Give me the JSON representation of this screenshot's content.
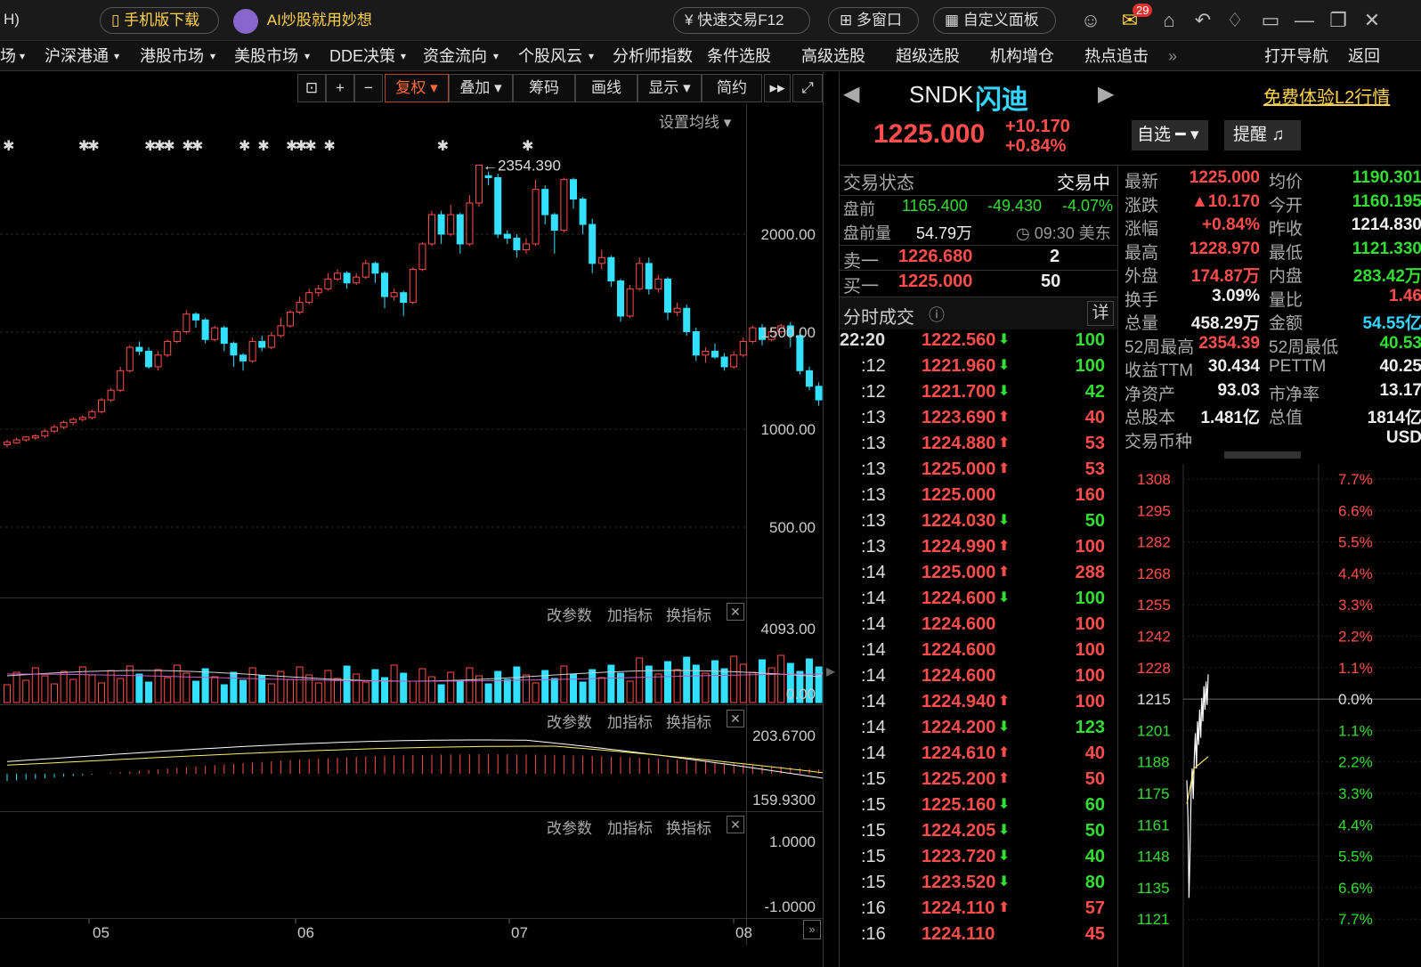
{
  "topbar": {
    "left_text": "H)",
    "mobile_download": "手机版下载",
    "ai_text": "AI炒股就用妙想",
    "quick_trade": "快速交易F12",
    "multi_window": "多窗口",
    "custom_panel": "自定义面板",
    "mail_badge": "29"
  },
  "menu": {
    "items": [
      "场",
      "沪深港通",
      "港股市场",
      "美股市场",
      "DDE决策",
      "资金流向",
      "个股风云",
      "分析师指数",
      "条件选股",
      "高级选股",
      "超级选股",
      "机构增仓",
      "热点追击",
      "»",
      "打开导航",
      "返回"
    ]
  },
  "toolbar": {
    "fuquan": "复权",
    "diejia": "叠加",
    "chouma": "筹码",
    "huaxian": "画线",
    "xianshi": "显示",
    "jianyue": "简约",
    "ma_setting": "设置均线"
  },
  "kline": {
    "max_label": "2354.390",
    "y_labels": [
      "2000.00",
      "1500.00",
      "1000.00",
      "500.00"
    ],
    "x_labels": [
      "05",
      "06",
      "07",
      "08"
    ],
    "candles": [
      [
        920,
        935,
        905,
        945
      ],
      [
        930,
        945,
        925,
        955
      ],
      [
        945,
        960,
        935,
        965
      ],
      [
        955,
        965,
        945,
        975
      ],
      [
        965,
        990,
        955,
        1000
      ],
      [
        990,
        1010,
        980,
        1025
      ],
      [
        1010,
        1035,
        1000,
        1045
      ],
      [
        1035,
        1050,
        1020,
        1060
      ],
      [
        1050,
        1060,
        1040,
        1070
      ],
      [
        1060,
        1090,
        1050,
        1100
      ],
      [
        1090,
        1150,
        1080,
        1160
      ],
      [
        1150,
        1200,
        1140,
        1210
      ],
      [
        1200,
        1300,
        1190,
        1320
      ],
      [
        1300,
        1420,
        1290,
        1430
      ],
      [
        1420,
        1400,
        1380,
        1450
      ],
      [
        1400,
        1320,
        1310,
        1420
      ],
      [
        1320,
        1380,
        1300,
        1400
      ],
      [
        1380,
        1450,
        1370,
        1460
      ],
      [
        1450,
        1500,
        1440,
        1510
      ],
      [
        1500,
        1590,
        1490,
        1610
      ],
      [
        1590,
        1560,
        1520,
        1600
      ],
      [
        1560,
        1460,
        1440,
        1570
      ],
      [
        1460,
        1520,
        1450,
        1530
      ],
      [
        1520,
        1440,
        1400,
        1530
      ],
      [
        1440,
        1380,
        1320,
        1450
      ],
      [
        1380,
        1350,
        1300,
        1390
      ],
      [
        1350,
        1450,
        1340,
        1470
      ],
      [
        1450,
        1420,
        1400,
        1480
      ],
      [
        1420,
        1480,
        1410,
        1500
      ],
      [
        1480,
        1530,
        1470,
        1570
      ],
      [
        1530,
        1600,
        1520,
        1610
      ],
      [
        1600,
        1650,
        1590,
        1680
      ],
      [
        1650,
        1700,
        1640,
        1720
      ],
      [
        1700,
        1720,
        1680,
        1740
      ],
      [
        1720,
        1770,
        1710,
        1800
      ],
      [
        1770,
        1800,
        1760,
        1820
      ],
      [
        1800,
        1750,
        1720,
        1810
      ],
      [
        1750,
        1780,
        1740,
        1800
      ],
      [
        1780,
        1850,
        1770,
        1870
      ],
      [
        1850,
        1800,
        1750,
        1860
      ],
      [
        1800,
        1680,
        1620,
        1810
      ],
      [
        1680,
        1700,
        1660,
        1720
      ],
      [
        1700,
        1650,
        1580,
        1710
      ],
      [
        1650,
        1820,
        1640,
        1830
      ],
      [
        1820,
        1950,
        1810,
        1960
      ],
      [
        1950,
        2100,
        1940,
        2120
      ],
      [
        2100,
        2000,
        1950,
        2120
      ],
      [
        2000,
        2100,
        1990,
        2150
      ],
      [
        2100,
        1950,
        1900,
        2110
      ],
      [
        1950,
        2160,
        1940,
        2200
      ],
      [
        2160,
        2354,
        2140,
        2354
      ],
      [
        2300,
        2290,
        2250,
        2320
      ],
      [
        2290,
        2000,
        1980,
        2310
      ],
      [
        2000,
        1980,
        1950,
        2020
      ],
      [
        1980,
        1920,
        1880,
        2000
      ],
      [
        1920,
        1950,
        1900,
        1980
      ],
      [
        1950,
        2230,
        1940,
        2280
      ],
      [
        2230,
        2100,
        2050,
        2250
      ],
      [
        2100,
        2020,
        1900,
        2110
      ],
      [
        2020,
        2280,
        2010,
        2290
      ],
      [
        2280,
        2180,
        2130,
        2290
      ],
      [
        2180,
        2050,
        2000,
        2190
      ],
      [
        2050,
        1850,
        1800,
        2080
      ],
      [
        1850,
        1880,
        1820,
        1920
      ],
      [
        1880,
        1760,
        1730,
        1890
      ],
      [
        1760,
        1580,
        1550,
        1770
      ],
      [
        1580,
        1720,
        1570,
        1740
      ],
      [
        1720,
        1850,
        1710,
        1880
      ],
      [
        1850,
        1720,
        1690,
        1880
      ],
      [
        1720,
        1770,
        1700,
        1790
      ],
      [
        1770,
        1600,
        1560,
        1780
      ],
      [
        1600,
        1620,
        1580,
        1650
      ],
      [
        1620,
        1500,
        1480,
        1640
      ],
      [
        1500,
        1380,
        1350,
        1520
      ],
      [
        1380,
        1400,
        1340,
        1420
      ],
      [
        1400,
        1370,
        1360,
        1440
      ],
      [
        1370,
        1320,
        1300,
        1390
      ],
      [
        1320,
        1380,
        1310,
        1400
      ],
      [
        1380,
        1450,
        1370,
        1470
      ],
      [
        1450,
        1520,
        1440,
        1530
      ],
      [
        1520,
        1460,
        1430,
        1540
      ],
      [
        1460,
        1500,
        1450,
        1520
      ],
      [
        1500,
        1530,
        1490,
        1540
      ],
      [
        1530,
        1480,
        1420,
        1550
      ],
      [
        1480,
        1300,
        1280,
        1500
      ],
      [
        1300,
        1220,
        1200,
        1320
      ],
      [
        1220,
        1150,
        1120,
        1240
      ],
      [
        1150,
        1050,
        1040,
        1180
      ],
      [
        1050,
        1100,
        1030,
        1110
      ],
      [
        1100,
        1240,
        1080,
        1250
      ],
      [
        1240,
        1280,
        1220,
        1290
      ],
      [
        1280,
        1380,
        1270,
        1400
      ],
      [
        1380,
        1220,
        1200,
        1400
      ],
      [
        1214.83,
        1225,
        1150,
        1230
      ]
    ]
  },
  "volume": {
    "max_label": "4093.00",
    "zero_label": "0.00",
    "params": "改参数",
    "add": "加指标",
    "swap": "换指标"
  },
  "macd": {
    "top_label": "203.6700",
    "bottom_label": "159.9300",
    "params": "改参数",
    "add": "加指标",
    "swap": "换指标"
  },
  "third": {
    "top_label": "1.0000",
    "bottom_label": "-1.0000",
    "params": "改参数",
    "add": "加指标",
    "swap": "换指标"
  },
  "quote": {
    "code": "SNDK",
    "name": "闪迪",
    "price": "1225.000",
    "change": "+10.170",
    "change_pct": "+0.84%",
    "l2_link": "免费体验L2行情",
    "zixuan": "自选",
    "tixing": "提醒",
    "trade_status_label": "交易状态",
    "trade_status": "交易中",
    "premarket_label": "盘前",
    "premarket_price": "1165.400",
    "premarket_change": "-49.430",
    "premarket_pct": "-4.07%",
    "premarket_vol_label": "盘前量",
    "premarket_vol": "54.79万",
    "premarket_time": "09:30 美东",
    "sell1_label": "卖一",
    "sell1_price": "1226.680",
    "sell1_vol": "2",
    "buy1_label": "买一",
    "buy1_price": "1225.000",
    "buy1_vol": "50",
    "ticks_title": "分时成交",
    "detail": "详"
  },
  "stats": [
    {
      "l1": "最新",
      "v1": "1225.000",
      "c1": "red",
      "l2": "均价",
      "v2": "1190.301",
      "c2": "green"
    },
    {
      "l1": "涨跌",
      "v1": "▲10.170",
      "c1": "red",
      "l2": "今开",
      "v2": "1160.195",
      "c2": "green"
    },
    {
      "l1": "涨幅",
      "v1": "+0.84%",
      "c1": "red",
      "l2": "昨收",
      "v2": "1214.830",
      "c2": "white"
    },
    {
      "l1": "最高",
      "v1": "1228.970",
      "c1": "red",
      "l2": "最低",
      "v2": "1121.330",
      "c2": "green"
    },
    {
      "l1": "外盘",
      "v1": "174.87万",
      "c1": "red",
      "l2": "内盘",
      "v2": "283.42万",
      "c2": "green"
    },
    {
      "l1": "换手",
      "v1": "3.09%",
      "c1": "white",
      "l2": "量比",
      "v2": "1.46",
      "c2": "red"
    },
    {
      "l1": "总量",
      "v1": "458.29万",
      "c1": "white",
      "l2": "金额",
      "v2": "54.55亿",
      "c2": "cyan"
    },
    {
      "l1": "52周最高",
      "v1": "2354.39",
      "c1": "red",
      "l2": "52周最低",
      "v2": "40.53",
      "c2": "green"
    },
    {
      "l1": "收益TTM",
      "v1": "30.434",
      "c1": "white",
      "l2": "PETTM",
      "v2": "40.25",
      "c2": "white"
    },
    {
      "l1": "净资产",
      "v1": "93.03",
      "c1": "white",
      "l2": "市净率",
      "v2": "13.17",
      "c2": "white"
    },
    {
      "l1": "总股本",
      "v1": "1.481亿",
      "c1": "white",
      "l2": "总值",
      "v2": "1814亿",
      "c2": "white"
    },
    {
      "l1": "交易币种",
      "v1": "",
      "c1": "white",
      "l2": "",
      "v2": "USD",
      "c2": "white"
    }
  ],
  "ticks": [
    {
      "t": "22:20",
      "p": "1222.560",
      "d": "down",
      "v": "100"
    },
    {
      "t": ":12",
      "p": "1221.960",
      "d": "down",
      "v": "100"
    },
    {
      "t": ":12",
      "p": "1221.700",
      "d": "down",
      "v": "42"
    },
    {
      "t": ":13",
      "p": "1223.690",
      "d": "up",
      "v": "40"
    },
    {
      "t": ":13",
      "p": "1224.880",
      "d": "up",
      "v": "53"
    },
    {
      "t": ":13",
      "p": "1225.000",
      "d": "up",
      "v": "53"
    },
    {
      "t": ":13",
      "p": "1225.000",
      "d": "",
      "v": "160"
    },
    {
      "t": ":13",
      "p": "1224.030",
      "d": "down",
      "v": "50"
    },
    {
      "t": ":13",
      "p": "1224.990",
      "d": "up",
      "v": "100"
    },
    {
      "t": ":14",
      "p": "1225.000",
      "d": "up",
      "v": "288"
    },
    {
      "t": ":14",
      "p": "1224.600",
      "d": "down",
      "v": "100"
    },
    {
      "t": ":14",
      "p": "1224.600",
      "d": "",
      "v": "100"
    },
    {
      "t": ":14",
      "p": "1224.600",
      "d": "",
      "v": "100"
    },
    {
      "t": ":14",
      "p": "1224.600",
      "d": "",
      "v": "100"
    },
    {
      "t": ":14",
      "p": "1224.940",
      "d": "up",
      "v": "100"
    },
    {
      "t": ":14",
      "p": "1224.200",
      "d": "down",
      "v": "123"
    },
    {
      "t": ":14",
      "p": "1224.610",
      "d": "up",
      "v": "40"
    },
    {
      "t": ":15",
      "p": "1225.200",
      "d": "up",
      "v": "50"
    },
    {
      "t": ":15",
      "p": "1225.160",
      "d": "down",
      "v": "60"
    },
    {
      "t": ":15",
      "p": "1224.205",
      "d": "down",
      "v": "50"
    },
    {
      "t": ":15",
      "p": "1223.720",
      "d": "down",
      "v": "40"
    },
    {
      "t": ":15",
      "p": "1223.520",
      "d": "down",
      "v": "80"
    },
    {
      "t": ":16",
      "p": "1224.110",
      "d": "up",
      "v": "57"
    },
    {
      "t": ":16",
      "p": "1224.110",
      "d": "",
      "v": "45"
    }
  ],
  "intraday": {
    "price_labels": [
      "1308",
      "1295",
      "1282",
      "1268",
      "1255",
      "1242",
      "1228",
      "1215",
      "1201",
      "1188",
      "1175",
      "1161",
      "1148",
      "1135",
      "1121"
    ],
    "pct_labels": [
      "7.7%",
      "6.6%",
      "5.5%",
      "4.4%",
      "3.3%",
      "2.2%",
      "1.1%",
      "0.0%",
      "1.1%",
      "2.2%",
      "3.3%",
      "4.4%",
      "5.5%",
      "6.6%",
      "7.7%"
    ],
    "prices": [
      1180,
      1165,
      1130,
      1150,
      1175,
      1185,
      1172,
      1190,
      1200,
      1185,
      1205,
      1195,
      1210,
      1198,
      1215,
      1205,
      1220,
      1210,
      1222,
      1212,
      1225
    ]
  },
  "colors": {
    "up": "#ff4d4d",
    "down": "#33e0ff",
    "ma": "#d0d0d0",
    "ma2": "#c060c0",
    "bg": "#000000"
  }
}
